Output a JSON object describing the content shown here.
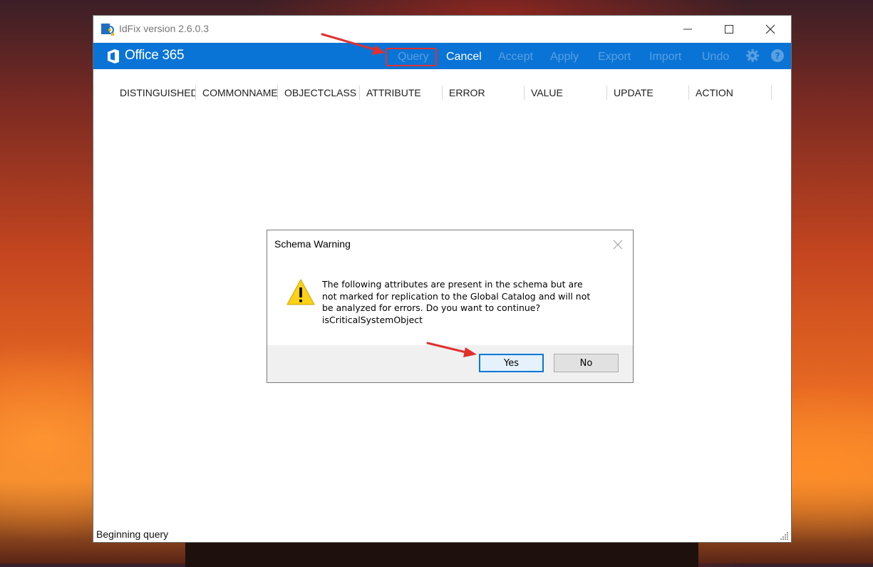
{
  "window": {
    "title": "IdFix version 2.6.0.3",
    "brand": "Office 365",
    "ribbon_color": "#0a74d6"
  },
  "commands": [
    {
      "label": "Query",
      "state": "disabled",
      "highlighted": true
    },
    {
      "label": "Cancel",
      "state": "enabled"
    },
    {
      "label": "Accept",
      "state": "disabled"
    },
    {
      "label": "Apply",
      "state": "disabled"
    },
    {
      "label": "Export",
      "state": "disabled"
    },
    {
      "label": "Import",
      "state": "disabled"
    },
    {
      "label": "Undo",
      "state": "disabled"
    }
  ],
  "icons": {
    "settings": "gear-icon",
    "help": "help-icon"
  },
  "grid": {
    "columns": [
      "DISTINGUISHED",
      "COMMONNAME",
      "OBJECTCLASS",
      "ATTRIBUTE",
      "ERROR",
      "VALUE",
      "UPDATE",
      "ACTION"
    ]
  },
  "status": {
    "text": "Beginning query"
  },
  "dialog": {
    "title": "Schema Warning",
    "message_lines": [
      "The following attributes are present in the schema but are",
      "not marked for replication to the Global Catalog and will not",
      "be analyzed for errors. Do you want to continue?",
      "isCriticalSystemObject"
    ],
    "yes_label": "Yes",
    "no_label": "No",
    "default_button": "Yes"
  },
  "annotation_color": "#e0302e"
}
